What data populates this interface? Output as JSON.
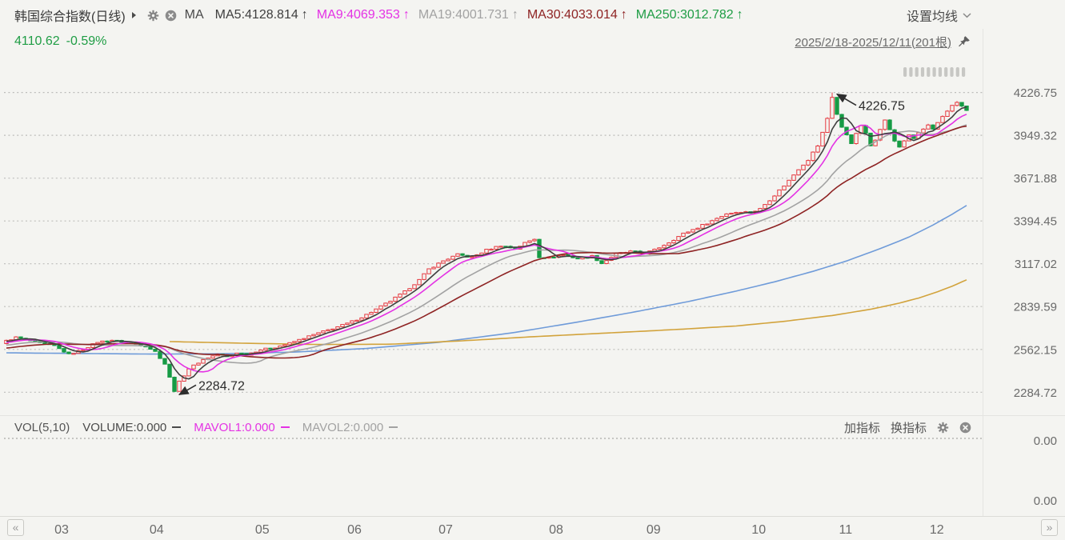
{
  "header": {
    "title": "韩国综合指数(日线)",
    "indicator_group": "MA",
    "ma_legend": [
      {
        "label": "MA5:4128.814",
        "trend": "↑",
        "color": "#3f3f3f"
      },
      {
        "label": "MA9:4069.353",
        "trend": "↑",
        "color": "#e432e4"
      },
      {
        "label": "MA19:4001.731",
        "trend": "↑",
        "color": "#a2a2a2"
      },
      {
        "label": "MA30:4033.014",
        "trend": "↑",
        "color": "#8e2323"
      },
      {
        "label": "MA250:3012.782",
        "trend": "↑",
        "color": "#1f9d45"
      }
    ],
    "settings_label": "设置均线"
  },
  "quote": {
    "last": "4110.62",
    "change_pct": "-0.59%",
    "color": "#1f9d45"
  },
  "range_selector": {
    "label": "2025/2/18-2025/12/11(201根)"
  },
  "volume_pane": {
    "indicator": "VOL(5,10)",
    "items": [
      {
        "label": "VOLUME:0.000",
        "color": "#4a4a4a"
      },
      {
        "label": "MAVOL1:0.000",
        "color": "#e432e4"
      },
      {
        "label": "MAVOL2:0.000",
        "color": "#a2a2a2"
      }
    ],
    "add_indicator": "加指标",
    "switch_indicator": "换指标",
    "y_ticks": [
      "0.00",
      "0.00"
    ]
  },
  "nav": {
    "left": "«",
    "right": "»"
  },
  "chart_data": {
    "type": "candlestick",
    "title": "韩国综合指数(日线)",
    "date_range": "2025/2/18-2025/12/11",
    "bar_count": 201,
    "y_axis": {
      "ticks": [
        4226.75,
        3949.32,
        3671.88,
        3394.45,
        3117.02,
        2839.59,
        2562.15,
        2284.72
      ]
    },
    "x_axis": {
      "ticks": [
        {
          "label": "03",
          "i": 11.5
        },
        {
          "label": "04",
          "i": 31.3
        },
        {
          "label": "05",
          "i": 53.3
        },
        {
          "label": "06",
          "i": 72.5
        },
        {
          "label": "07",
          "i": 91.5
        },
        {
          "label": "08",
          "i": 114.5
        },
        {
          "label": "09",
          "i": 134.8
        },
        {
          "label": "10",
          "i": 156.7
        },
        {
          "label": "11",
          "i": 174.8
        },
        {
          "label": "12",
          "i": 193.8
        }
      ]
    },
    "first_open": 2600,
    "last_close": 4110.62,
    "low_point": {
      "i": 35,
      "value": 2284.72,
      "label": "2284.72"
    },
    "high_point": {
      "i": 172,
      "value": 4226.75,
      "label": "4226.75"
    },
    "close_anchors": [
      [
        0,
        2618
      ],
      [
        2,
        2640
      ],
      [
        4,
        2626
      ],
      [
        7,
        2602
      ],
      [
        10,
        2585
      ],
      [
        13,
        2530
      ],
      [
        16,
        2562
      ],
      [
        19,
        2610
      ],
      [
        22,
        2622
      ],
      [
        25,
        2606
      ],
      [
        27,
        2597
      ],
      [
        29,
        2583
      ],
      [
        31,
        2548
      ],
      [
        33,
        2468
      ],
      [
        34,
        2380
      ],
      [
        35,
        2290
      ],
      [
        36,
        2352
      ],
      [
        38,
        2438
      ],
      [
        41,
        2496
      ],
      [
        44,
        2532
      ],
      [
        46,
        2514
      ],
      [
        48,
        2541
      ],
      [
        50,
        2529
      ],
      [
        53,
        2560
      ],
      [
        56,
        2576
      ],
      [
        59,
        2602
      ],
      [
        62,
        2636
      ],
      [
        65,
        2668
      ],
      [
        68,
        2698
      ],
      [
        71,
        2730
      ],
      [
        74,
        2770
      ],
      [
        77,
        2822
      ],
      [
        80,
        2876
      ],
      [
        83,
        2936
      ],
      [
        86,
        3012
      ],
      [
        88,
        3082
      ],
      [
        91,
        3136
      ],
      [
        94,
        3176
      ],
      [
        97,
        3158
      ],
      [
        100,
        3206
      ],
      [
        103,
        3236
      ],
      [
        106,
        3214
      ],
      [
        108,
        3252
      ],
      [
        110,
        3278
      ],
      [
        111,
        3162
      ],
      [
        113,
        3156
      ],
      [
        116,
        3176
      ],
      [
        119,
        3150
      ],
      [
        122,
        3166
      ],
      [
        124,
        3120
      ],
      [
        127,
        3180
      ],
      [
        130,
        3196
      ],
      [
        133,
        3186
      ],
      [
        135,
        3206
      ],
      [
        138,
        3256
      ],
      [
        141,
        3312
      ],
      [
        144,
        3352
      ],
      [
        147,
        3396
      ],
      [
        150,
        3442
      ],
      [
        153,
        3456
      ],
      [
        155,
        3448
      ],
      [
        157,
        3472
      ],
      [
        159,
        3532
      ],
      [
        161,
        3592
      ],
      [
        163,
        3656
      ],
      [
        165,
        3732
      ],
      [
        167,
        3792
      ],
      [
        169,
        3882
      ],
      [
        170,
        3965
      ],
      [
        171,
        4060
      ],
      [
        172,
        4195
      ],
      [
        173,
        4085
      ],
      [
        174,
        3998
      ],
      [
        175,
        3955
      ],
      [
        176,
        3902
      ],
      [
        177,
        3955
      ],
      [
        178,
        4015
      ],
      [
        179,
        3958
      ],
      [
        180,
        3882
      ],
      [
        181,
        3925
      ],
      [
        182,
        3995
      ],
      [
        183,
        4045
      ],
      [
        184,
        3988
      ],
      [
        185,
        3908
      ],
      [
        186,
        3874
      ],
      [
        187,
        3915
      ],
      [
        188,
        3955
      ],
      [
        189,
        3922
      ],
      [
        190,
        3965
      ],
      [
        191,
        3988
      ],
      [
        192,
        4015
      ],
      [
        193,
        3985
      ],
      [
        194,
        4025
      ],
      [
        195,
        4065
      ],
      [
        196,
        4105
      ],
      [
        197,
        4145
      ],
      [
        198,
        4168
      ],
      [
        199,
        4135
      ],
      [
        200,
        4110.62
      ]
    ],
    "ma_series": [
      {
        "name": "MA5",
        "window": 5,
        "color": "#3f3f3f"
      },
      {
        "name": "MA9",
        "window": 9,
        "color": "#e432e4"
      },
      {
        "name": "MA19",
        "window": 19,
        "color": "#a2a2a2"
      },
      {
        "name": "MA30",
        "window": 30,
        "color": "#8e2323"
      },
      {
        "name": "MA-blue",
        "color": "#6f9bd9",
        "anchors": [
          [
            0,
            2540
          ],
          [
            15,
            2536
          ],
          [
            30,
            2532
          ],
          [
            45,
            2534
          ],
          [
            60,
            2545
          ],
          [
            75,
            2568
          ],
          [
            90,
            2608
          ],
          [
            105,
            2668
          ],
          [
            118,
            2734
          ],
          [
            130,
            2800
          ],
          [
            142,
            2872
          ],
          [
            152,
            2940
          ],
          [
            160,
            3000
          ],
          [
            168,
            3068
          ],
          [
            175,
            3135
          ],
          [
            182,
            3215
          ],
          [
            188,
            3290
          ],
          [
            193,
            3368
          ],
          [
            197,
            3438
          ],
          [
            200,
            3495
          ]
        ]
      },
      {
        "name": "MA250",
        "color": "#d2a33c",
        "anchors": [
          [
            34,
            2613
          ],
          [
            50,
            2602
          ],
          [
            65,
            2594
          ],
          [
            80,
            2596
          ],
          [
            95,
            2618
          ],
          [
            110,
            2645
          ],
          [
            125,
            2668
          ],
          [
            140,
            2692
          ],
          [
            152,
            2714
          ],
          [
            162,
            2744
          ],
          [
            172,
            2782
          ],
          [
            180,
            2822
          ],
          [
            186,
            2862
          ],
          [
            190,
            2895
          ],
          [
            194,
            2936
          ],
          [
            197,
            2972
          ],
          [
            200,
            3012.78
          ]
        ]
      }
    ],
    "colors": {
      "up": "#e5383f",
      "down": "#169b45",
      "grid": "#bdbdbb",
      "bg": "#f4f4f1"
    }
  }
}
